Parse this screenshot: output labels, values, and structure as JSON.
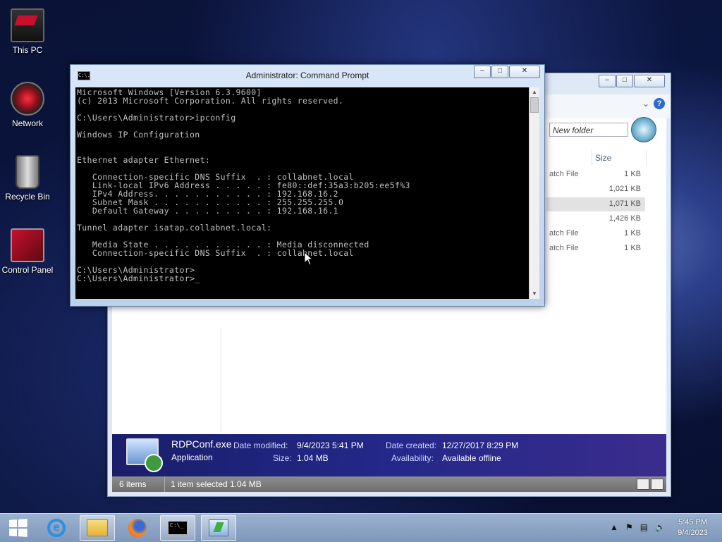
{
  "desktop": {
    "icons": [
      {
        "label": "This PC",
        "icon": "computer-icon"
      },
      {
        "label": "Network",
        "icon": "network-icon"
      },
      {
        "label": "Recycle Bin",
        "icon": "recycle-bin-icon"
      },
      {
        "label": "Control Panel",
        "icon": "control-panel-icon"
      }
    ]
  },
  "cmd": {
    "title": "Administrator: Command Prompt",
    "icon_text": "C:\\.",
    "output": "Microsoft Windows [Version 6.3.9600]\n(c) 2013 Microsoft Corporation. All rights reserved.\n\nC:\\Users\\Administrator>ipconfig\n\nWindows IP Configuration\n\n\nEthernet adapter Ethernet:\n\n   Connection-specific DNS Suffix  . : collabnet.local\n   Link-local IPv6 Address . . . . . : fe80::def:35a3:b205:ee5f%3\n   IPv4 Address. . . . . . . . . . . : 192.168.16.2\n   Subnet Mask . . . . . . . . . . . : 255.255.255.0\n   Default Gateway . . . . . . . . . : 192.168.16.1\n\nTunnel adapter isatap.collabnet.local:\n\n   Media State . . . . . . . . . . . : Media disconnected\n   Connection-specific DNS Suffix  . : collabnet.local\n\nC:\\Users\\Administrator>\nC:\\Users\\Administrator>_"
  },
  "explorer": {
    "search_placeholder": "New folder",
    "column_size": "Size",
    "rows": [
      {
        "type": "atch File",
        "size": "1 KB",
        "selected": false
      },
      {
        "type": "",
        "size": "1,021 KB",
        "selected": false
      },
      {
        "type": "",
        "size": "1,071 KB",
        "selected": true
      },
      {
        "type": "",
        "size": "1,426 KB",
        "selected": false
      },
      {
        "type": "atch File",
        "size": "1 KB",
        "selected": false
      },
      {
        "type": "atch File",
        "size": "1 KB",
        "selected": false
      }
    ],
    "details": {
      "name": "RDPConf.exe",
      "type": "Application",
      "modified_label": "Date modified:",
      "modified_value": "9/4/2023 5:41 PM",
      "size_label": "Size:",
      "size_value": "1.04 MB",
      "created_label": "Date created:",
      "created_value": "12/27/2017 8:29 PM",
      "availability_label": "Availability:",
      "availability_value": "Available offline"
    },
    "status": {
      "items": "6 items",
      "selected": "1 item selected  1.04 MB"
    }
  },
  "taskbar": {
    "cmd_icon_text": "C:\\_",
    "clock_time": "5:45 PM",
    "clock_date": "9/4/2023"
  }
}
